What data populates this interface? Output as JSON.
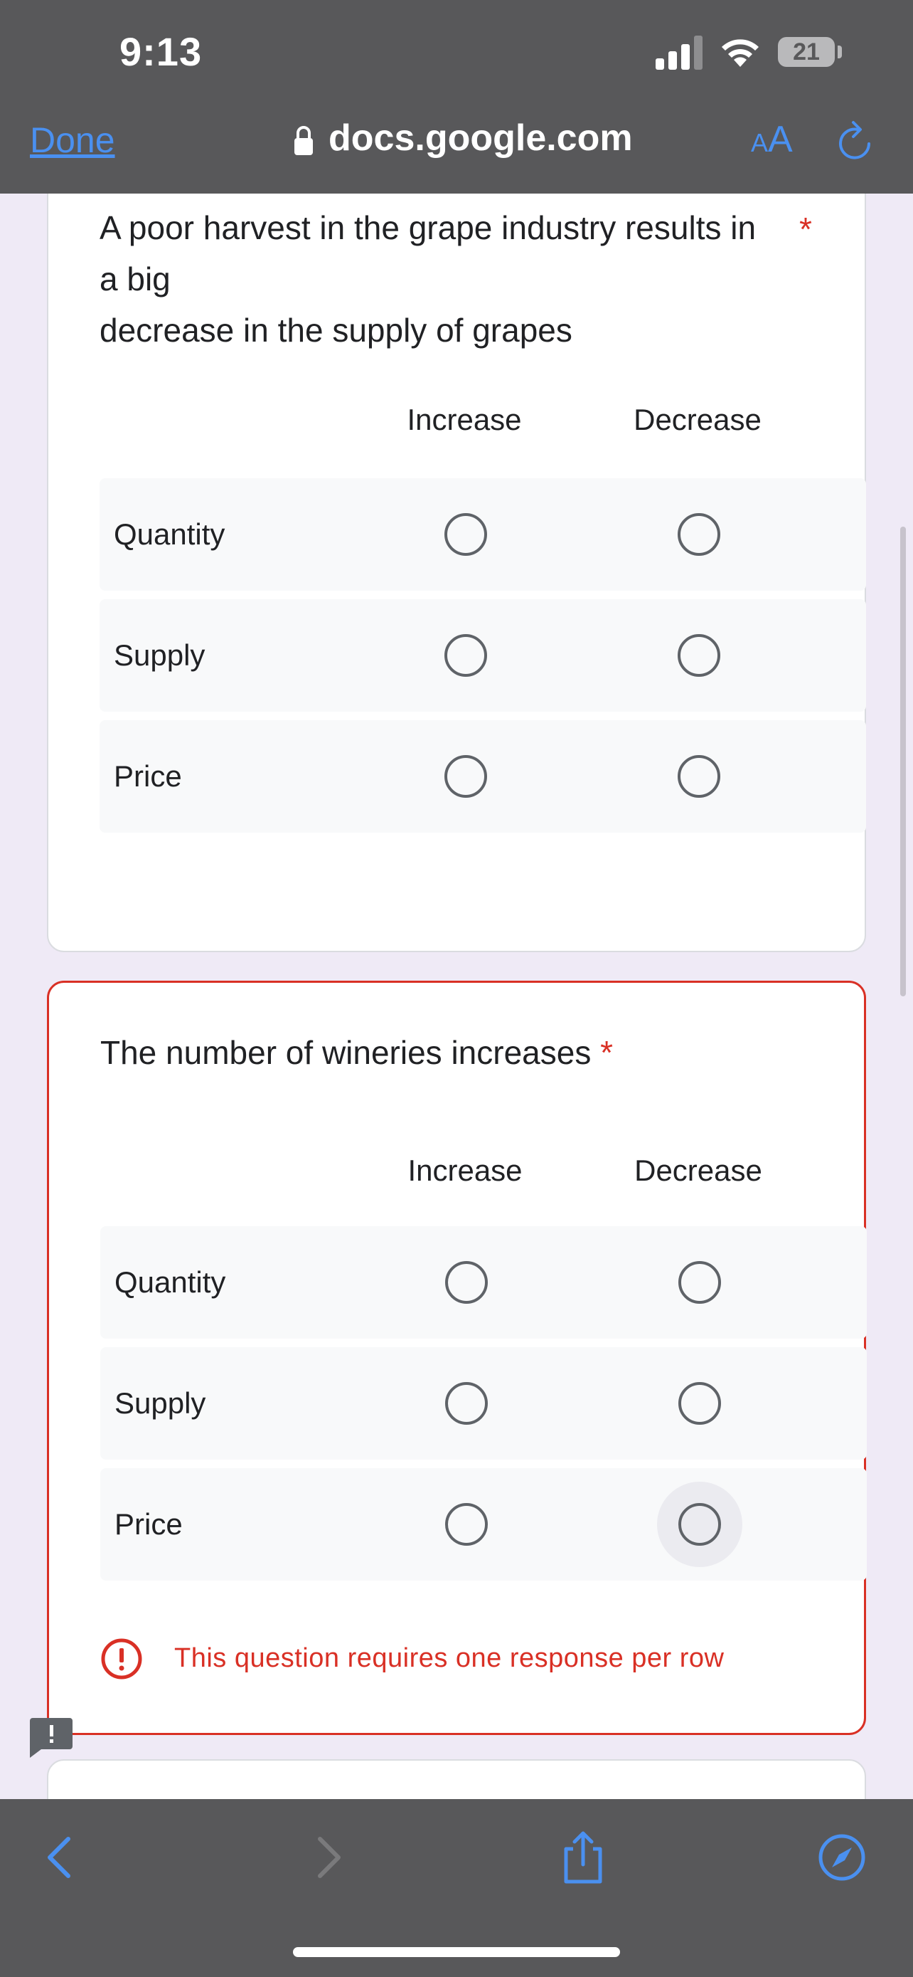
{
  "status_bar": {
    "time": "9:13",
    "battery": "21"
  },
  "browser": {
    "done_label": "Done",
    "url": "docs.google.com",
    "text_size_small": "A",
    "text_size_large": "A"
  },
  "questions": [
    {
      "title_line1": "A poor harvest in the grape industry results in",
      "title_line2": "a big",
      "title_line3": "decrease in the supply of grapes",
      "required_mark": "*",
      "columns": [
        "Increase",
        "Decrease"
      ],
      "rows": [
        "Quantity",
        "Supply",
        "Price"
      ]
    },
    {
      "title": "The number of wineries increases",
      "required_mark": "*",
      "columns": [
        "Increase",
        "Decrease"
      ],
      "rows": [
        "Quantity",
        "Supply",
        "Price"
      ],
      "error": "This question requires one response per row"
    }
  ],
  "colors": {
    "accent": "#4a90f0",
    "error": "#d93025",
    "chrome": "#58585a",
    "page_bg": "#efeaf6"
  },
  "icons": [
    "lock-icon",
    "reload-icon",
    "error-icon",
    "feedback-icon",
    "back-icon",
    "forward-icon",
    "share-icon",
    "compass-icon"
  ]
}
